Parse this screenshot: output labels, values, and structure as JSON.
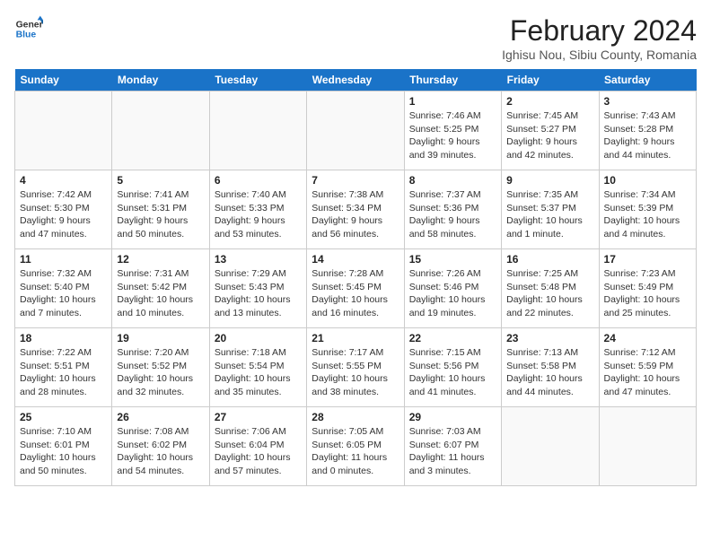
{
  "logo": {
    "line1": "General",
    "line2": "Blue"
  },
  "title": "February 2024",
  "location": "Ighisu Nou, Sibiu County, Romania",
  "days_of_week": [
    "Sunday",
    "Monday",
    "Tuesday",
    "Wednesday",
    "Thursday",
    "Friday",
    "Saturday"
  ],
  "weeks": [
    [
      {
        "day": "",
        "info": ""
      },
      {
        "day": "",
        "info": ""
      },
      {
        "day": "",
        "info": ""
      },
      {
        "day": "",
        "info": ""
      },
      {
        "day": "1",
        "info": "Sunrise: 7:46 AM\nSunset: 5:25 PM\nDaylight: 9 hours\nand 39 minutes."
      },
      {
        "day": "2",
        "info": "Sunrise: 7:45 AM\nSunset: 5:27 PM\nDaylight: 9 hours\nand 42 minutes."
      },
      {
        "day": "3",
        "info": "Sunrise: 7:43 AM\nSunset: 5:28 PM\nDaylight: 9 hours\nand 44 minutes."
      }
    ],
    [
      {
        "day": "4",
        "info": "Sunrise: 7:42 AM\nSunset: 5:30 PM\nDaylight: 9 hours\nand 47 minutes."
      },
      {
        "day": "5",
        "info": "Sunrise: 7:41 AM\nSunset: 5:31 PM\nDaylight: 9 hours\nand 50 minutes."
      },
      {
        "day": "6",
        "info": "Sunrise: 7:40 AM\nSunset: 5:33 PM\nDaylight: 9 hours\nand 53 minutes."
      },
      {
        "day": "7",
        "info": "Sunrise: 7:38 AM\nSunset: 5:34 PM\nDaylight: 9 hours\nand 56 minutes."
      },
      {
        "day": "8",
        "info": "Sunrise: 7:37 AM\nSunset: 5:36 PM\nDaylight: 9 hours\nand 58 minutes."
      },
      {
        "day": "9",
        "info": "Sunrise: 7:35 AM\nSunset: 5:37 PM\nDaylight: 10 hours\nand 1 minute."
      },
      {
        "day": "10",
        "info": "Sunrise: 7:34 AM\nSunset: 5:39 PM\nDaylight: 10 hours\nand 4 minutes."
      }
    ],
    [
      {
        "day": "11",
        "info": "Sunrise: 7:32 AM\nSunset: 5:40 PM\nDaylight: 10 hours\nand 7 minutes."
      },
      {
        "day": "12",
        "info": "Sunrise: 7:31 AM\nSunset: 5:42 PM\nDaylight: 10 hours\nand 10 minutes."
      },
      {
        "day": "13",
        "info": "Sunrise: 7:29 AM\nSunset: 5:43 PM\nDaylight: 10 hours\nand 13 minutes."
      },
      {
        "day": "14",
        "info": "Sunrise: 7:28 AM\nSunset: 5:45 PM\nDaylight: 10 hours\nand 16 minutes."
      },
      {
        "day": "15",
        "info": "Sunrise: 7:26 AM\nSunset: 5:46 PM\nDaylight: 10 hours\nand 19 minutes."
      },
      {
        "day": "16",
        "info": "Sunrise: 7:25 AM\nSunset: 5:48 PM\nDaylight: 10 hours\nand 22 minutes."
      },
      {
        "day": "17",
        "info": "Sunrise: 7:23 AM\nSunset: 5:49 PM\nDaylight: 10 hours\nand 25 minutes."
      }
    ],
    [
      {
        "day": "18",
        "info": "Sunrise: 7:22 AM\nSunset: 5:51 PM\nDaylight: 10 hours\nand 28 minutes."
      },
      {
        "day": "19",
        "info": "Sunrise: 7:20 AM\nSunset: 5:52 PM\nDaylight: 10 hours\nand 32 minutes."
      },
      {
        "day": "20",
        "info": "Sunrise: 7:18 AM\nSunset: 5:54 PM\nDaylight: 10 hours\nand 35 minutes."
      },
      {
        "day": "21",
        "info": "Sunrise: 7:17 AM\nSunset: 5:55 PM\nDaylight: 10 hours\nand 38 minutes."
      },
      {
        "day": "22",
        "info": "Sunrise: 7:15 AM\nSunset: 5:56 PM\nDaylight: 10 hours\nand 41 minutes."
      },
      {
        "day": "23",
        "info": "Sunrise: 7:13 AM\nSunset: 5:58 PM\nDaylight: 10 hours\nand 44 minutes."
      },
      {
        "day": "24",
        "info": "Sunrise: 7:12 AM\nSunset: 5:59 PM\nDaylight: 10 hours\nand 47 minutes."
      }
    ],
    [
      {
        "day": "25",
        "info": "Sunrise: 7:10 AM\nSunset: 6:01 PM\nDaylight: 10 hours\nand 50 minutes."
      },
      {
        "day": "26",
        "info": "Sunrise: 7:08 AM\nSunset: 6:02 PM\nDaylight: 10 hours\nand 54 minutes."
      },
      {
        "day": "27",
        "info": "Sunrise: 7:06 AM\nSunset: 6:04 PM\nDaylight: 10 hours\nand 57 minutes."
      },
      {
        "day": "28",
        "info": "Sunrise: 7:05 AM\nSunset: 6:05 PM\nDaylight: 11 hours\nand 0 minutes."
      },
      {
        "day": "29",
        "info": "Sunrise: 7:03 AM\nSunset: 6:07 PM\nDaylight: 11 hours\nand 3 minutes."
      },
      {
        "day": "",
        "info": ""
      },
      {
        "day": "",
        "info": ""
      }
    ]
  ]
}
